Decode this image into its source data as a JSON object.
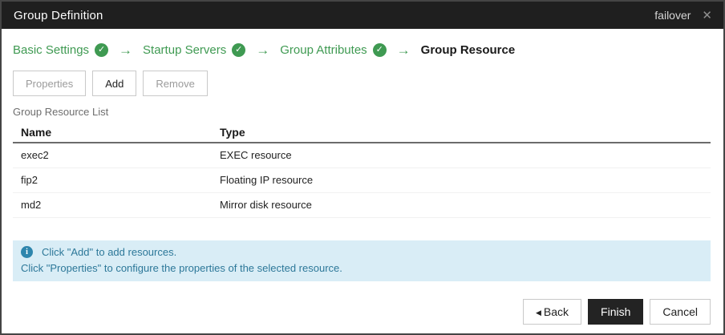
{
  "titlebar": {
    "title": "Group Definition",
    "group_name": "failover",
    "close_glyph": "✕"
  },
  "wizard": {
    "arrow": "→",
    "check_glyph": "✓",
    "steps": [
      {
        "label": "Basic Settings",
        "state": "completed"
      },
      {
        "label": "Startup Servers",
        "state": "completed"
      },
      {
        "label": "Group Attributes",
        "state": "completed"
      },
      {
        "label": "Group Resource",
        "state": "current"
      }
    ]
  },
  "toolbar": {
    "properties_label": "Properties",
    "add_label": "Add",
    "remove_label": "Remove"
  },
  "list": {
    "caption": "Group Resource List",
    "columns": {
      "name": "Name",
      "type": "Type"
    },
    "rows": [
      {
        "name": "exec2",
        "type": "EXEC resource"
      },
      {
        "name": "fip2",
        "type": "Floating IP resource"
      },
      {
        "name": "md2",
        "type": "Mirror disk resource"
      }
    ]
  },
  "info": {
    "icon_glyph": "i",
    "line1": "Click \"Add\" to add resources.",
    "line2": "Click \"Properties\" to configure the properties of the selected resource."
  },
  "footer": {
    "back_arrow": "◀",
    "back_label": "Back",
    "finish_label": "Finish",
    "cancel_label": "Cancel"
  },
  "colors": {
    "accent_green": "#3f9a52",
    "titlebar_bg": "#1f1f1f",
    "info_bg": "#d9edf6",
    "info_text": "#2d7899",
    "finish_bg": "#232323"
  }
}
